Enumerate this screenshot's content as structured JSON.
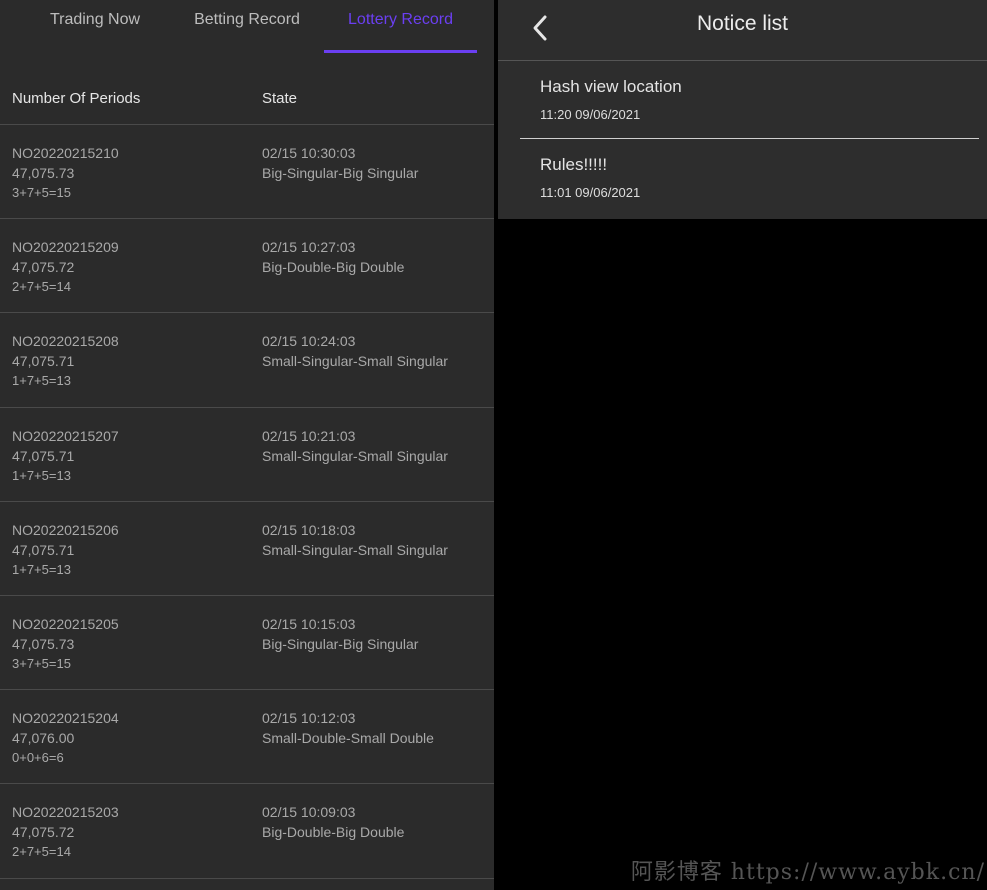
{
  "tabs": [
    {
      "label": "Trading Now",
      "active": false
    },
    {
      "label": "Betting Record",
      "active": false
    },
    {
      "label": "Lottery Record",
      "active": true
    }
  ],
  "colors": {
    "accent": "#6b3ff2",
    "panel_bg": "#2b2b2b",
    "text_muted": "#a9a9a9"
  },
  "lottery": {
    "headers": {
      "periods": "Number Of Periods",
      "state": "State"
    },
    "rows": [
      {
        "period": "NO20220215210",
        "value": "47,075.73",
        "formula": "3+7+5=15",
        "time": "02/15 10:30:03",
        "result": "Big-Singular-Big Singular"
      },
      {
        "period": "NO20220215209",
        "value": "47,075.72",
        "formula": "2+7+5=14",
        "time": "02/15 10:27:03",
        "result": "Big-Double-Big Double"
      },
      {
        "period": "NO20220215208",
        "value": "47,075.71",
        "formula": "1+7+5=13",
        "time": "02/15 10:24:03",
        "result": "Small-Singular-Small Singular"
      },
      {
        "period": "NO20220215207",
        "value": "47,075.71",
        "formula": "1+7+5=13",
        "time": "02/15 10:21:03",
        "result": "Small-Singular-Small Singular"
      },
      {
        "period": "NO20220215206",
        "value": "47,075.71",
        "formula": "1+7+5=13",
        "time": "02/15 10:18:03",
        "result": "Small-Singular-Small Singular"
      },
      {
        "period": "NO20220215205",
        "value": "47,075.73",
        "formula": "3+7+5=15",
        "time": "02/15 10:15:03",
        "result": "Big-Singular-Big Singular"
      },
      {
        "period": "NO20220215204",
        "value": "47,076.00",
        "formula": "0+0+6=6",
        "time": "02/15 10:12:03",
        "result": "Small-Double-Small Double"
      },
      {
        "period": "NO20220215203",
        "value": "47,075.72",
        "formula": "2+7+5=14",
        "time": "02/15 10:09:03",
        "result": "Big-Double-Big Double"
      }
    ]
  },
  "notice_panel": {
    "title": "Notice list",
    "back_icon": "chevron-left-icon",
    "items": [
      {
        "title": "Hash view location",
        "date": "11:20 09/06/2021"
      },
      {
        "title": "Rules!!!!!",
        "date": "11:01 09/06/2021"
      }
    ]
  },
  "watermark": "阿影博客 https://www.aybk.cn/"
}
